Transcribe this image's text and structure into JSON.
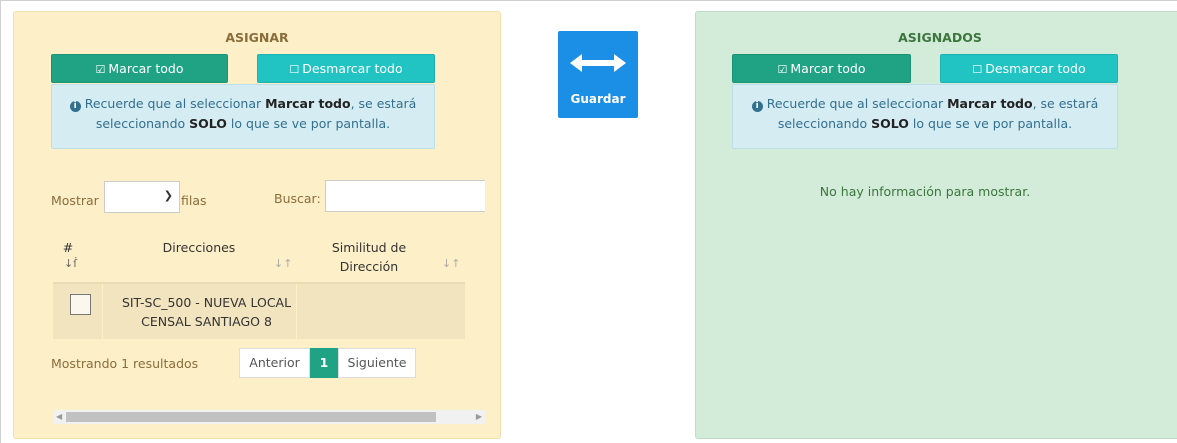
{
  "assign_panel": {
    "title": "ASIGNAR",
    "mark_all_label": "Marcar todo",
    "unmark_all_label": "Desmarcar todo",
    "info": {
      "part1": "Recuerde que al seleccionar ",
      "bold1": "Marcar todo",
      "part2": ", se estará seleccionando ",
      "bold2": "SOLO",
      "part3": " lo que se ve por pantalla."
    },
    "show_label": "Mostrar",
    "rows_label": "filas",
    "page_size": "",
    "search_label": "Buscar:",
    "search_value": "",
    "columns": [
      "#",
      "Direcciones",
      "Similitud de Dirección"
    ],
    "rows": [
      {
        "checked": false,
        "address": "SIT-SC_500 - NUEVA LOCAL CENSAL SANTIAGO 8",
        "similarity": ""
      }
    ],
    "showing_text": "Mostrando 1 resultados",
    "pagination": {
      "prev": "Anterior",
      "current": "1",
      "next": "Siguiente"
    }
  },
  "save_button": {
    "label": "Guardar",
    "icon": "left-right-arrow-icon"
  },
  "assigned_panel": {
    "title": "ASIGNADOS",
    "mark_all_label": "Marcar todo",
    "unmark_all_label": "Desmarcar todo",
    "info": {
      "part1": "Recuerde que al seleccionar ",
      "bold1": "Marcar todo",
      "part2": ", se estará seleccionando ",
      "bold2": "SOLO",
      "part3": " lo que se ve por pantalla."
    },
    "empty_text": "No hay información para mostrar."
  },
  "colors": {
    "assign_bg": "#fdefc8",
    "assigned_bg": "#d3ebd9",
    "mark_btn": "#1fa384",
    "unmark_btn": "#21c3c3",
    "save_btn": "#1b8fe6"
  }
}
